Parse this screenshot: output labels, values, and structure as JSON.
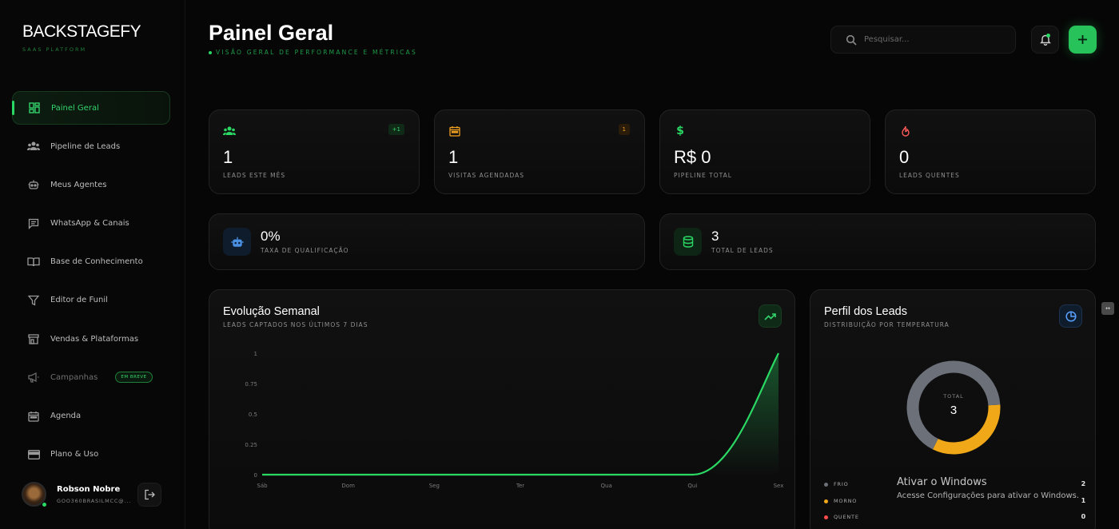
{
  "brand": {
    "name": "BACKSTAGEFY",
    "tagline": "SAAS PLATFORM"
  },
  "sidebar": {
    "items": [
      {
        "label": "Painel Geral",
        "icon": "dashboard-icon",
        "active": true
      },
      {
        "label": "Pipeline de Leads",
        "icon": "users-icon"
      },
      {
        "label": "Meus Agentes",
        "icon": "robot-icon"
      },
      {
        "label": "WhatsApp & Canais",
        "icon": "chat-icon"
      },
      {
        "label": "Base de Conhecimento",
        "icon": "book-icon"
      },
      {
        "label": "Editor de Funil",
        "icon": "filter-icon"
      },
      {
        "label": "Vendas & Plataformas",
        "icon": "store-icon"
      },
      {
        "label": "Campanhas",
        "icon": "megaphone-icon",
        "badge": "EM BREVE"
      },
      {
        "label": "Agenda",
        "icon": "calendar-icon"
      },
      {
        "label": "Plano & Uso",
        "icon": "card-icon"
      }
    ]
  },
  "user": {
    "name": "Robson Nobre",
    "email": "GOO360BRASILMCC@..."
  },
  "header": {
    "title": "Painel Geral",
    "subtitle": "VISÃO GERAL DE PERFORMANCE E MÉTRICAS",
    "search_placeholder": "Pesquisar...",
    "accent": "#2ad864"
  },
  "stats": [
    {
      "value": "1",
      "label": "LEADS ESTE MÊS",
      "icon": "users-icon",
      "badge": "+1",
      "color": "#2ad864"
    },
    {
      "value": "1",
      "label": "VISITAS AGENDADAS",
      "icon": "calendar-icon",
      "badge": "1",
      "color": "#f0a020"
    },
    {
      "value": "R$ 0",
      "label": "PIPELINE TOTAL",
      "icon": "dollar-icon",
      "color": "#2ad864"
    },
    {
      "value": "0",
      "label": "LEADS QUENTES",
      "icon": "flame-icon",
      "color": "#ff5a5a"
    }
  ],
  "kpis": [
    {
      "value": "0%",
      "label": "TAXA DE QUALIFICAÇÃO",
      "icon": "robot-icon",
      "color": "#4a90e2"
    },
    {
      "value": "3",
      "label": "TOTAL DE LEADS",
      "icon": "database-icon",
      "color": "#2ad864"
    }
  ],
  "weekly": {
    "title": "Evolução Semanal",
    "subtitle": "LEADS CAPTADOS NOS ÚLTIMOS 7 DIAS",
    "icon": "trending-up-icon"
  },
  "profile": {
    "title": "Perfil dos Leads",
    "subtitle": "DISTRIBUIÇÃO POR TEMPERATURA",
    "icon": "pie-icon",
    "total_label": "TOTAL",
    "total_value": "3"
  },
  "chart_data": [
    {
      "type": "area",
      "categories": [
        "Sáb",
        "Dom",
        "Seg",
        "Ter",
        "Qua",
        "Qui",
        "Sex"
      ],
      "values": [
        0,
        0,
        0,
        0,
        0,
        0,
        1
      ],
      "y_ticks": [
        "0",
        "0.25",
        "0.5",
        "0.75",
        "1"
      ],
      "ylim": [
        0,
        1
      ],
      "color": "#2ad864"
    },
    {
      "type": "pie",
      "donut": true,
      "slices": [
        {
          "name": "FRIO",
          "value": 2,
          "color": "#6b7079"
        },
        {
          "name": "MORNO",
          "value": 1,
          "color": "#f0a818"
        },
        {
          "name": "QUENTE",
          "value": 0,
          "color": "#ff4d4d"
        }
      ]
    }
  ],
  "watermark": {
    "title": "Ativar o Windows",
    "subtitle": "Acesse Configurações para ativar o Windows."
  }
}
